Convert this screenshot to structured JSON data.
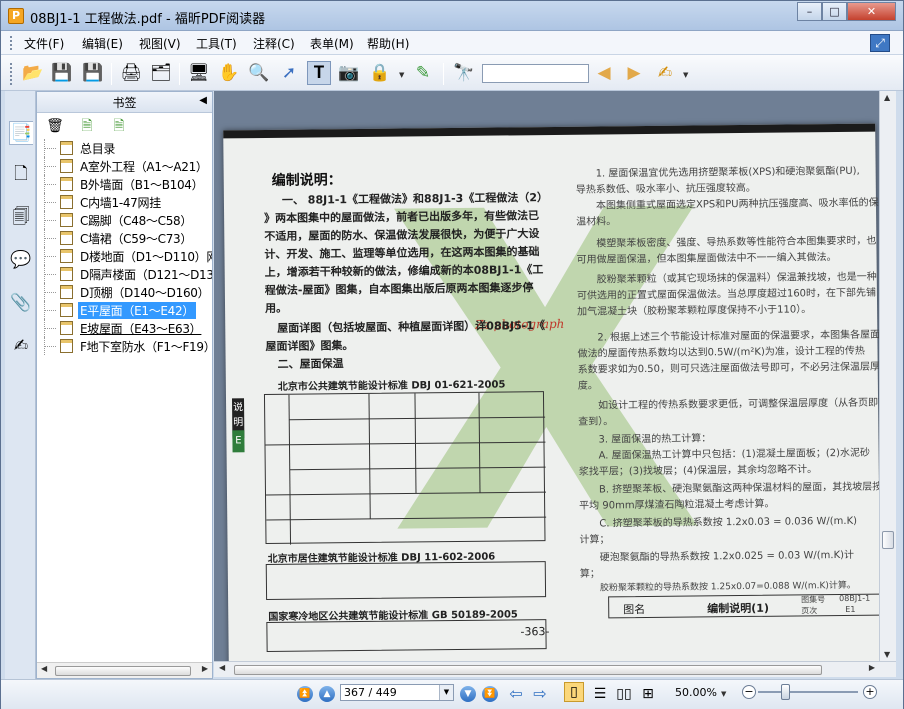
{
  "window": {
    "title": "08BJ1-1 工程做法.pdf - 福昕PDF阅读器"
  },
  "window_controls": {
    "minimize": "–",
    "restore": "□",
    "close": "✕"
  },
  "menu": {
    "items": [
      "文件(F)",
      "编辑(E)",
      "视图(V)",
      "工具(T)",
      "注释(C)",
      "表单(M)",
      "帮助(H)"
    ]
  },
  "toolbar": {
    "icons": [
      "open-icon",
      "save-icon",
      "save-as-icon",
      "print-icon",
      "properties-icon",
      "fullscreen-icon",
      "hand-tool-icon",
      "zoom-tool-icon",
      "select-tool-icon",
      "text-select-icon",
      "snapshot-icon",
      "security-icon",
      "sign-icon",
      "find-icon",
      "prev-result-icon",
      "next-result-icon",
      "highlight-icon"
    ],
    "search_value": ""
  },
  "sidebar": {
    "tabs": [
      "bookmarks-tab-icon",
      "pages-tab-icon",
      "layers-tab-icon",
      "comments-tab-icon",
      "attachments-tab-icon",
      "signatures-tab-icon"
    ]
  },
  "bookmarks": {
    "title": "书签",
    "items": [
      {
        "label": "总目录",
        "selected": false
      },
      {
        "label": "A室外工程（A1～A21）",
        "selected": false
      },
      {
        "label": "B外墙面（B1～B104）",
        "selected": false
      },
      {
        "label": "C内墙1-47网挂",
        "selected": false
      },
      {
        "label": "C踢脚（C48～C58）",
        "selected": false
      },
      {
        "label": "C墙裙（C59～C73）",
        "selected": false
      },
      {
        "label": "D楼地面（D1～D110）网",
        "selected": false
      },
      {
        "label": "D隔声楼面（D121～D13",
        "selected": false
      },
      {
        "label": "D顶棚（D140～D160）",
        "selected": false
      },
      {
        "label": "E平屋面（E1～E42）",
        "selected": true
      },
      {
        "label": "E坡屋面（E43～E63）",
        "selected": false
      },
      {
        "label": "F地下室防水（F1～F19）",
        "selected": false
      }
    ]
  },
  "document": {
    "heading": "编制说明：",
    "left_lines": [
      "一、 88J1-1《工程做法》和88J1-3《工程做法（2）",
      "》两本图集中的屋面做法，前者已出版多年，有些做法已",
      "不适用，屋面的防水、保温做法发展很快，为便于广大设",
      "计、开发、施工、监理等单位选用，在这两本图集的基础",
      "上，增添若干种较新的做法，修编成新的本08BJ1-1《工",
      "程做法-屋面》图集，自本图集出版后原两本图集逐步停",
      "用。",
      "屋面详图（包括坡屋面、种植屋面详图）详08BJ5-1《",
      "屋面详图》图集。",
      "二、屋面保温"
    ],
    "watermark_text": "Zz photograph",
    "std1_title": "北京市公共建筑节能设计标准  DBJ 01-621-2005",
    "std2_title": "北京市居住建筑节能设计标准  DBJ 11-602-2006",
    "std3_title": "国家寒冷地区公共建筑节能设计标准  GB 50189-2005",
    "right_lines": [
      "1. 屋面保温宜优先选用挤塑聚苯板(XPS)和硬泡聚氨酯(PU),",
      "导热系数低、吸水率小、抗压强度较高。",
      "本图集侧重式屋面选定XPS和PU两种抗压强度高、吸水率低的保",
      "温材料。",
      "模塑聚苯板密度、强度、导热系数等性能符合本图集要求时，也",
      "可用做屋面保温，但本图集屋面做法中不一一编入其做法。",
      "胶粉聚苯颗粒（或其它现场抹的保温料）保温兼找坡，也是一种",
      "可供选用的正置式屋面保温做法。当总厚度超过160时，在下部先铺",
      "加气混凝土块（胶粉聚苯颗粒厚度保持不小于110）。",
      "2. 根据上述三个节能设计标准对屋面的保温要求，本图集各屋面",
      "做法的屋面传热系数均以达到0.5W/(m²K)为准，设计工程的传热",
      "系数要求如为0.50，则可只选注屋面做法号即可，不必另注保温层厚",
      "度。",
      "如设计工程的传热系数要求更低，可调整保温层厚度（从各页即可",
      "查到）。",
      "3. 屋面保温的热工计算：",
      "A. 屋面保温热工计算中只包括：(1)混凝土屋面板；(2)水泥砂",
      "浆找平层；(3)找坡层；(4)保温层，其余均忽略不计。",
      "B. 挤塑聚苯板、硬泡聚氨酯这两种保温材料的屋面，其找坡层按",
      "平均 90mm厚煤渣石陶粒混凝土考虑计算。",
      "C. 挤塑聚苯板的导热系数按 1.2x0.03 = 0.036 W/(m.K)",
      "计算；",
      "硬泡聚氨酯的导热系数按 1.2x0.025 = 0.03 W/(m.K)计",
      "算；",
      "胶粉聚苯颗粒的导热系数按 1.25x0.07=0.088 W/(m.K)计算。"
    ],
    "footer": {
      "fig_label": "图名",
      "fig_name": "编制说明(1)",
      "code_label": "图集号",
      "code": "08BJ1-1",
      "page_label": "页次",
      "page": "E1"
    },
    "page_number": "-363-",
    "side_label": "说明",
    "side_badge": "E"
  },
  "status": {
    "page_field": "367 / 449",
    "zoom": "50.00%"
  }
}
